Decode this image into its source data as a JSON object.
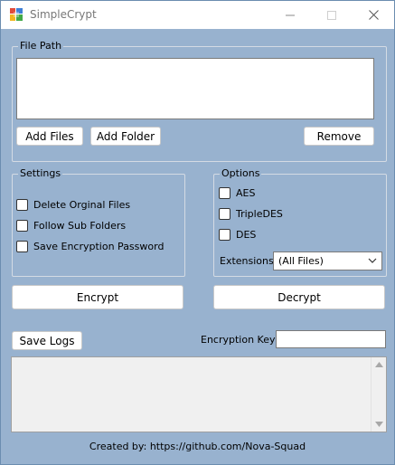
{
  "window": {
    "title": "SimpleCrypt"
  },
  "file_path": {
    "group_title": "File Path",
    "add_files_label": "Add Files",
    "add_folder_label": "Add Folder",
    "remove_label": "Remove"
  },
  "settings": {
    "group_title": "Settings",
    "items": [
      {
        "label": "Delete Orginal Files",
        "checked": false
      },
      {
        "label": "Follow Sub Folders",
        "checked": false
      },
      {
        "label": "Save Encryption Password",
        "checked": false
      }
    ]
  },
  "options": {
    "group_title": "Options",
    "items": [
      {
        "label": "AES",
        "checked": false
      },
      {
        "label": "TripleDES",
        "checked": false
      },
      {
        "label": "DES",
        "checked": false
      }
    ],
    "extensions_label": "Extensions",
    "extensions_value": "(All Files)"
  },
  "actions": {
    "encrypt_label": "Encrypt",
    "decrypt_label": "Decrypt",
    "save_logs_label": "Save Logs",
    "encryption_key_label": "Encryption Key -",
    "encryption_key_value": ""
  },
  "footer": {
    "credit": "Created by: https://github.com/Nova-Squad"
  },
  "colors": {
    "form_background": "#98b2cf",
    "titlebar": "#ffffff"
  },
  "icons": {
    "app": "app-grid-icon",
    "minimize": "minimize-icon",
    "maximize": "maximize-icon",
    "close": "close-icon",
    "dropdown": "chevron-down-icon",
    "scroll_up": "scroll-up-arrow-icon",
    "scroll_down": "scroll-down-arrow-icon"
  }
}
